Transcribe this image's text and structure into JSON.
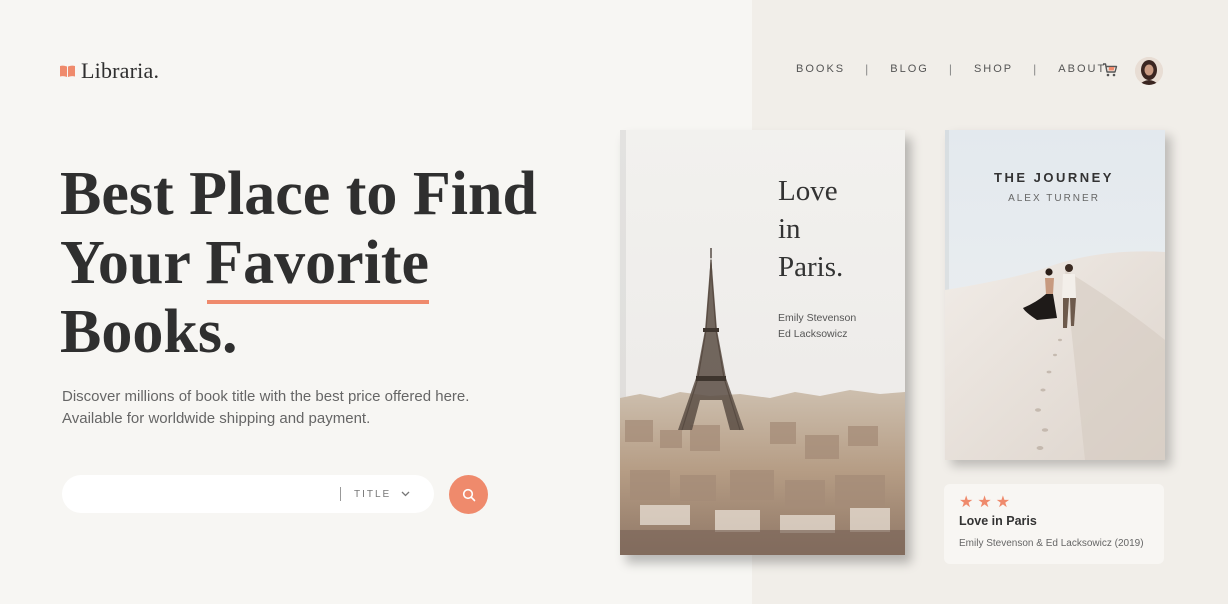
{
  "brand": {
    "name": "Libraria.",
    "icon": "open-book-icon",
    "accent": "#ef8a6c"
  },
  "nav": {
    "items": [
      {
        "label": "BOOKS"
      },
      {
        "label": "BLOG"
      },
      {
        "label": "SHOP"
      },
      {
        "label": "ABOUT"
      }
    ],
    "separator": "|",
    "cart_icon": "cart-icon",
    "avatar_icon": "user-avatar"
  },
  "hero": {
    "title_line1": "Best Place to Find",
    "title_line2_a": "Your ",
    "title_line2_b": "Favorite",
    "title_line3": "Books.",
    "subtitle_line1": "Discover millions of book title with the best price offered here.",
    "subtitle_line2": "Available for worldwide shipping and payment."
  },
  "search": {
    "value": "",
    "placeholder": "",
    "filter_label": "TITLE",
    "filter_icon": "chevron-down-icon",
    "button_icon": "search-icon"
  },
  "books": [
    {
      "title_lines": [
        "Love",
        "in",
        "Paris."
      ],
      "authors": [
        "Emily Stevenson",
        "Ed Lacksowicz"
      ],
      "cover_art": "eiffel-tower-paris-skyline"
    },
    {
      "title": "THE JOURNEY",
      "author": "ALEX TURNER",
      "cover_art": "couple-walking-on-sand-dune"
    }
  ],
  "featured": {
    "rating": 3,
    "stars": "★★★",
    "title": "Love in Paris",
    "meta": "Emily Stevenson & Ed Lacksowicz (2019)"
  }
}
